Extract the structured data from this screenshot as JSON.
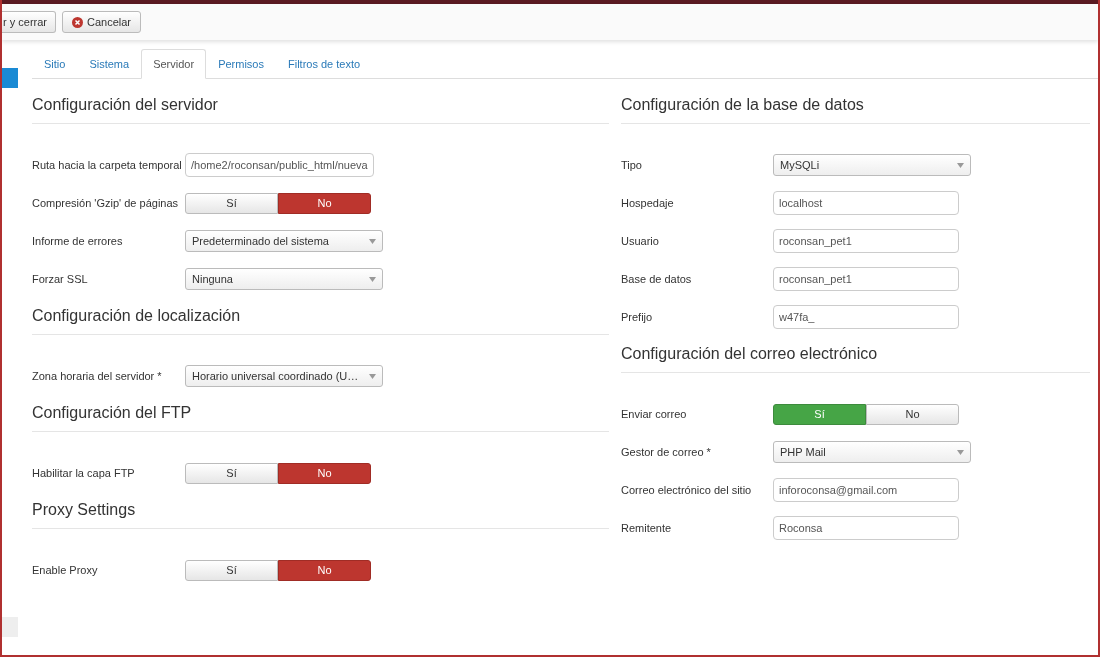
{
  "toolbar": {
    "buttons": [
      {
        "kind": "plain",
        "label": "r y cerrar"
      },
      {
        "kind": "cancel",
        "label": "Cancelar"
      }
    ]
  },
  "tabs": [
    {
      "label": "Sitio",
      "selected": false
    },
    {
      "label": "Sistema",
      "selected": false
    },
    {
      "label": "Servidor",
      "selected": true
    },
    {
      "label": "Permisos",
      "selected": false
    },
    {
      "label": "Filtros de texto",
      "selected": false
    }
  ],
  "columns": [
    {
      "sections": [
        {
          "title": "Configuración del servidor",
          "fields": [
            {
              "kind": "text",
              "label": "Ruta hacia la carpeta temporal",
              "value": "/home2/roconsan/public_html/nueva"
            },
            {
              "kind": "toggle",
              "label": "Compresión 'Gzip' de páginas",
              "options": [
                {
                  "label": "Sí",
                  "selected": false
                },
                {
                  "label": "No",
                  "selected": true
                }
              ]
            },
            {
              "kind": "select",
              "label": "Informe de errores",
              "value": "Predeterminado del sistema"
            },
            {
              "kind": "select",
              "label": "Forzar SSL",
              "value": "Ninguna"
            }
          ]
        },
        {
          "title": "Configuración de localización",
          "fields": [
            {
              "kind": "select",
              "label": "Zona horaria del servidor *",
              "value": "Horario universal coordinado (U…"
            }
          ]
        },
        {
          "title": "Configuración del FTP",
          "fields": [
            {
              "kind": "toggle",
              "label": "Habilitar la capa FTP",
              "options": [
                {
                  "label": "Sí",
                  "selected": false
                },
                {
                  "label": "No",
                  "selected": true
                }
              ]
            }
          ]
        },
        {
          "title": "Proxy Settings",
          "fields": [
            {
              "kind": "toggle",
              "label": "Enable Proxy",
              "options": [
                {
                  "label": "Sí",
                  "selected": false
                },
                {
                  "label": "No",
                  "selected": true
                }
              ]
            }
          ]
        }
      ]
    },
    {
      "sections": [
        {
          "title": "Configuración de la base de datos",
          "fields": [
            {
              "kind": "select",
              "label": "Tipo",
              "value": "MySQLi"
            },
            {
              "kind": "text",
              "label": "Hospedaje",
              "value": "localhost"
            },
            {
              "kind": "text",
              "label": "Usuario",
              "value": "roconsan_pet1"
            },
            {
              "kind": "text",
              "label": "Base de datos",
              "value": "roconsan_pet1"
            },
            {
              "kind": "text",
              "label": "Prefijo",
              "value": "w47fa_"
            }
          ]
        },
        {
          "title": "Configuración del correo electrónico",
          "fields": [
            {
              "kind": "toggle",
              "label": "Enviar correo",
              "options": [
                {
                  "label": "Sí",
                  "selected": true
                },
                {
                  "label": "No",
                  "selected": false
                }
              ]
            },
            {
              "kind": "select",
              "label": "Gestor de correo *",
              "value": "PHP Mail"
            },
            {
              "kind": "text",
              "label": "Correo electrónico del sitio",
              "value": "inforoconsa@gmail.com"
            },
            {
              "kind": "text",
              "label": "Remitente",
              "value": "Roconsa"
            }
          ]
        }
      ]
    }
  ]
}
